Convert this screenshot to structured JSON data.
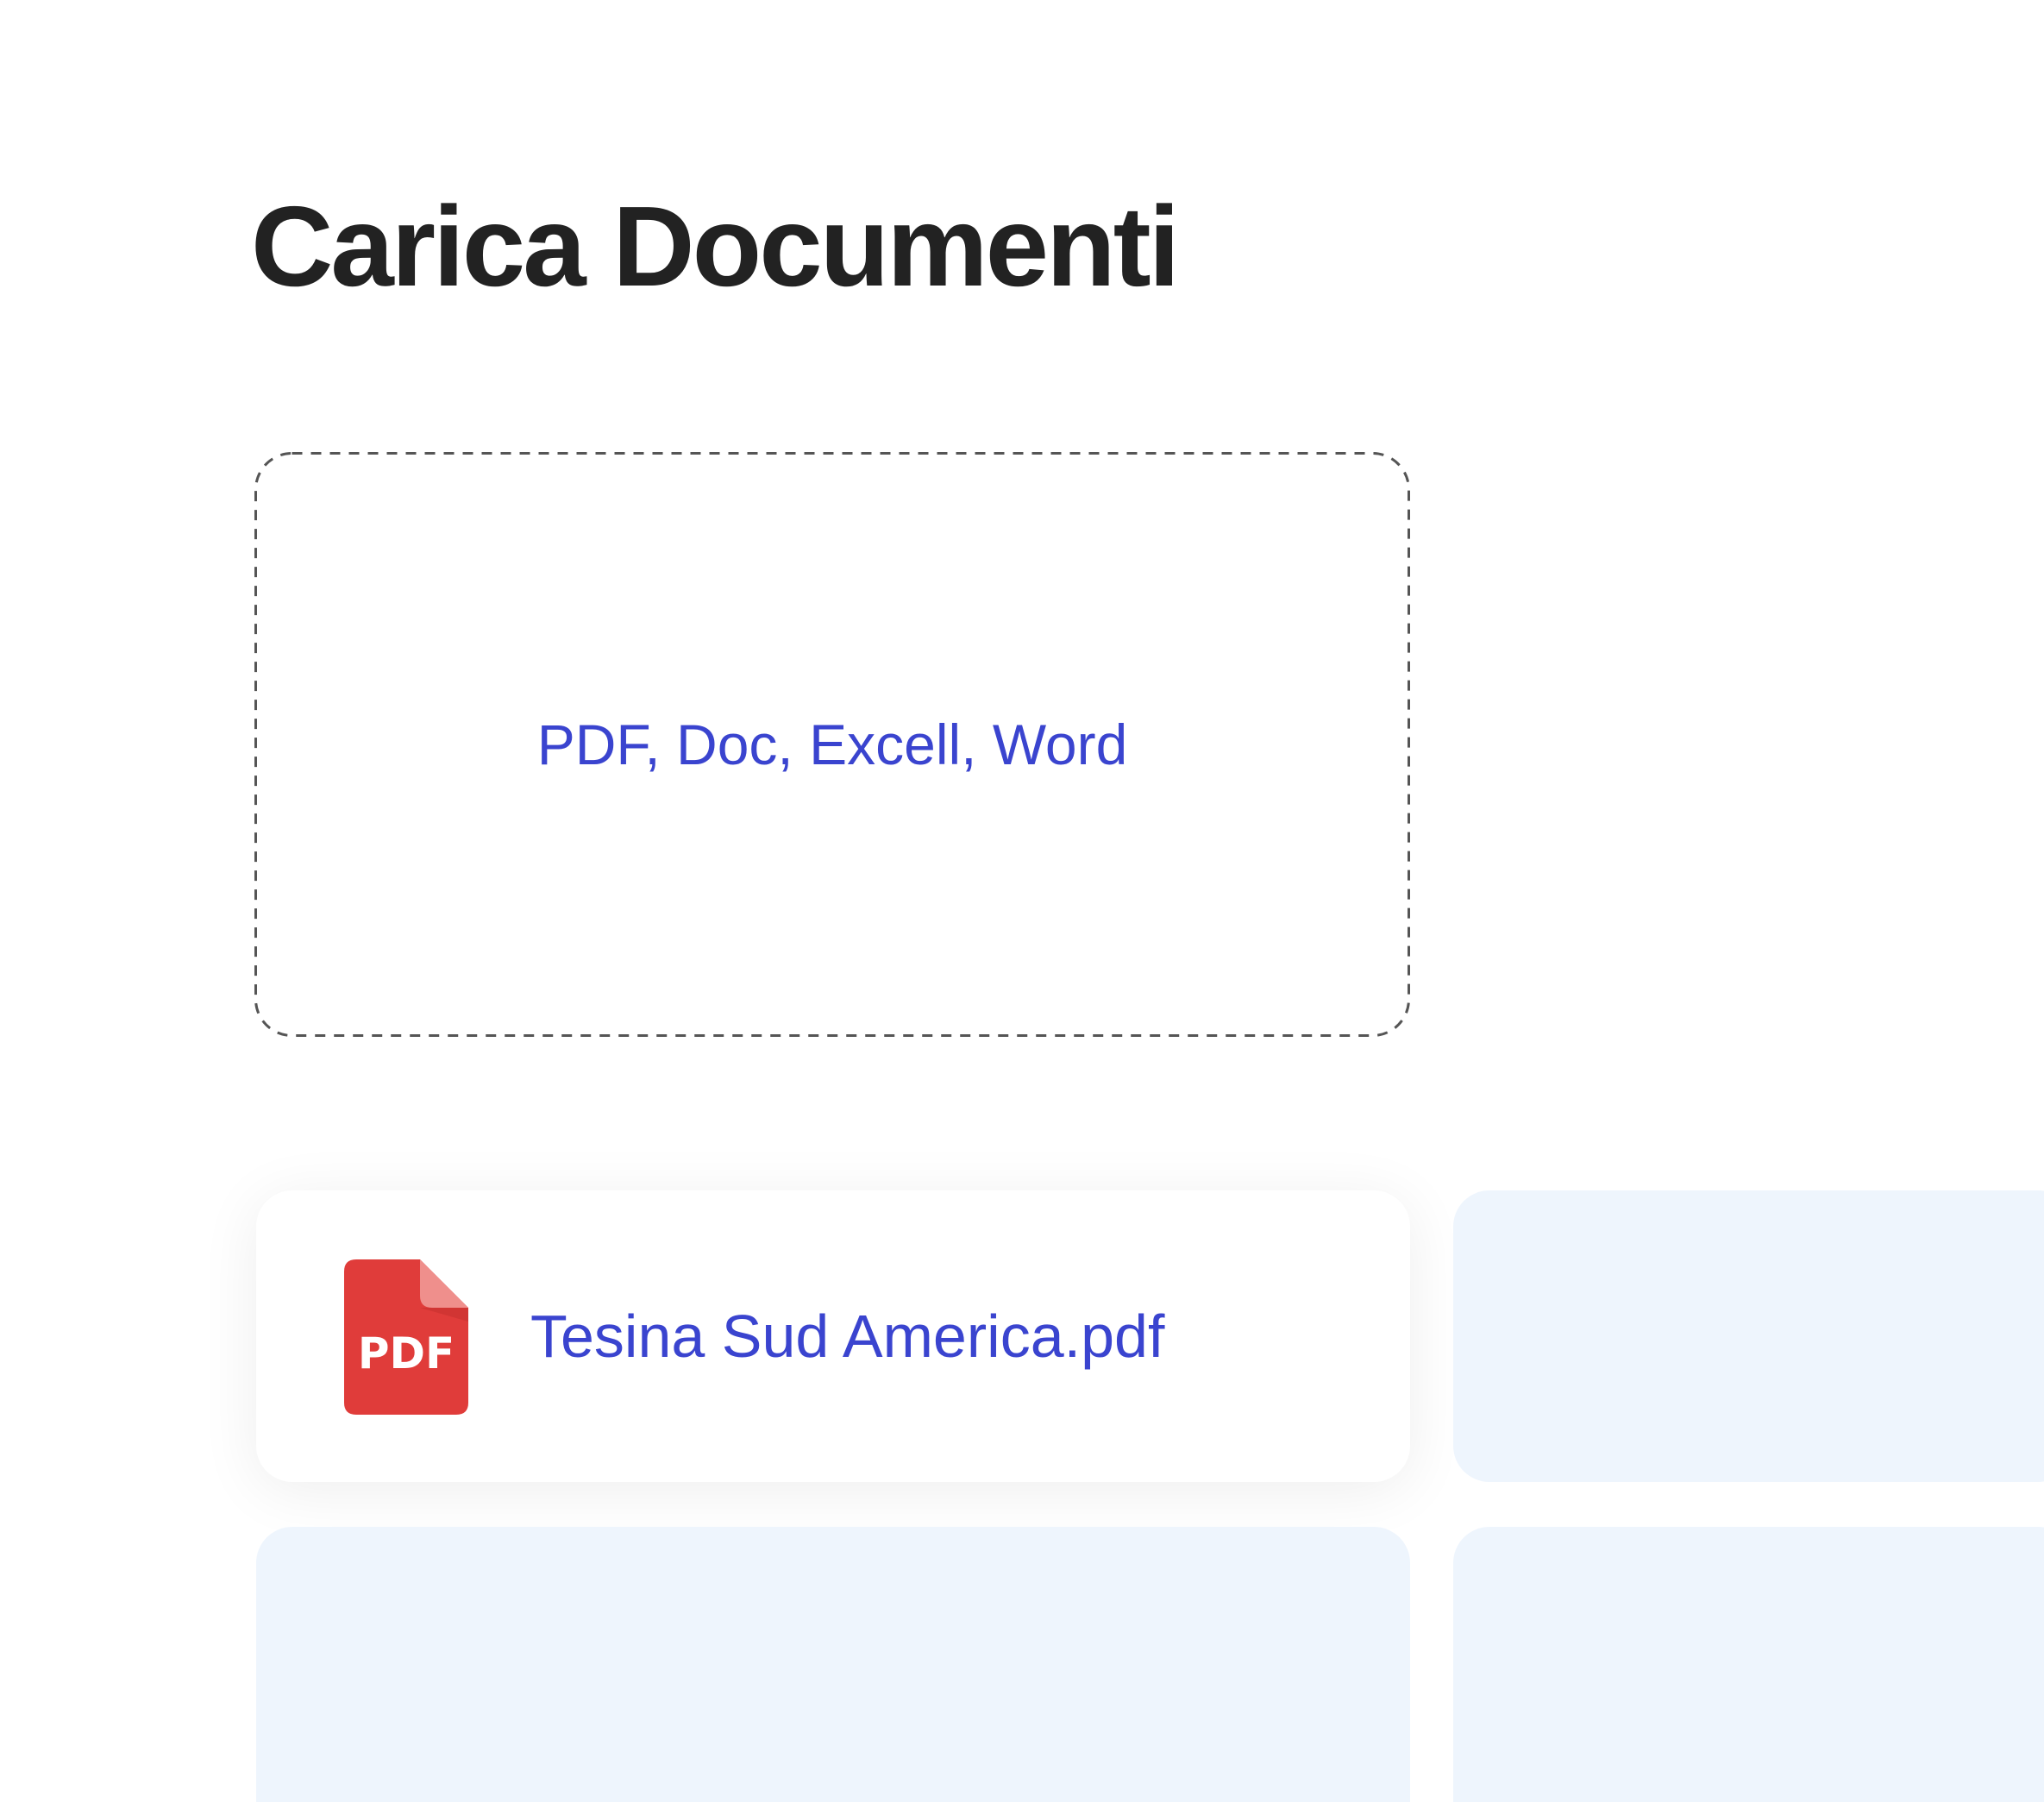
{
  "page": {
    "title": "Carica Documenti"
  },
  "dropzone": {
    "accepted_types_label": "PDF, Doc, Excell, Word"
  },
  "files": [
    {
      "name": "Tesina Sud America.pdf",
      "icon": "pdf-file-icon",
      "icon_label": "PDF"
    }
  ],
  "colors": {
    "accent": "#3a44cf",
    "pdf_red": "#e03c3a",
    "placeholder_bg": "#eef5fd",
    "title": "#222222",
    "dash_border": "#555555"
  }
}
